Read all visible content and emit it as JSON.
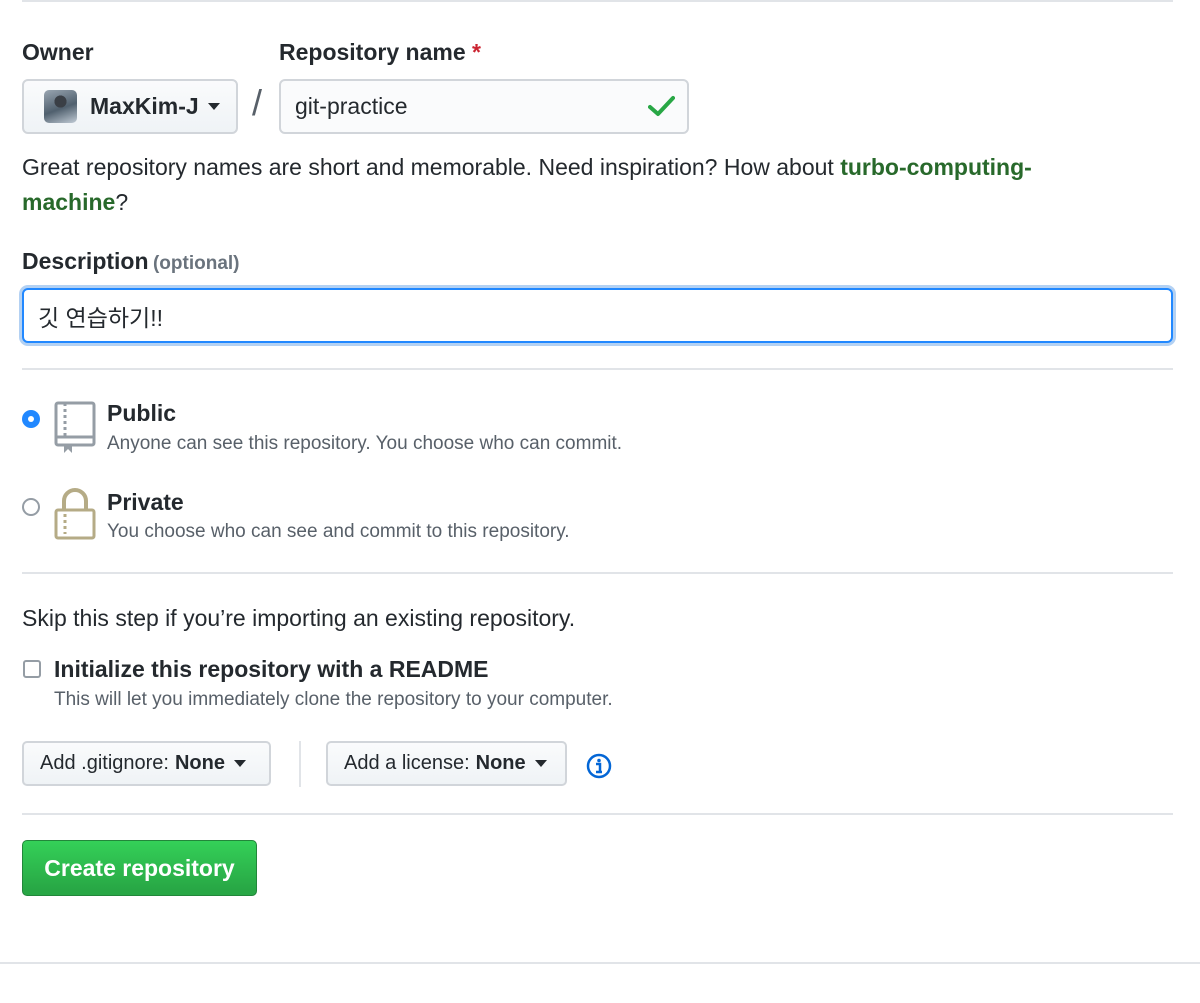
{
  "owner": {
    "label": "Owner",
    "value": "MaxKim-J"
  },
  "repo_name": {
    "label": "Repository name",
    "required_mark": "*",
    "value": "git-practice"
  },
  "separator": "/",
  "name_help": {
    "prefix": "Great repository names are short and memorable. Need inspiration? How about ",
    "suggestion_line1": "turbo-computing-",
    "suggestion_line2": "machine",
    "suffix": "?"
  },
  "description": {
    "label": "Description",
    "optional": "(optional)",
    "value": "깃 연습하기!!"
  },
  "visibility": {
    "public": {
      "title": "Public",
      "desc": "Anyone can see this repository. You choose who can commit.",
      "selected": true
    },
    "private": {
      "title": "Private",
      "desc": "You choose who can see and commit to this repository.",
      "selected": false
    }
  },
  "import_note": "Skip this step if you’re importing an existing repository.",
  "readme": {
    "label": "Initialize this repository with a README",
    "desc": "This will let you immediately clone the repository to your computer.",
    "checked": false
  },
  "gitignore": {
    "label": "Add .gitignore:",
    "value": "None"
  },
  "license": {
    "label": "Add a license:",
    "value": "None"
  },
  "create_button": "Create repository",
  "colors": {
    "accent": "#2188ff",
    "success": "#28a745",
    "suggestion": "#28692b",
    "required": "#cb2431"
  },
  "icons": [
    "chevron-down-icon",
    "check-icon",
    "repo-icon",
    "lock-icon",
    "info-icon"
  ]
}
